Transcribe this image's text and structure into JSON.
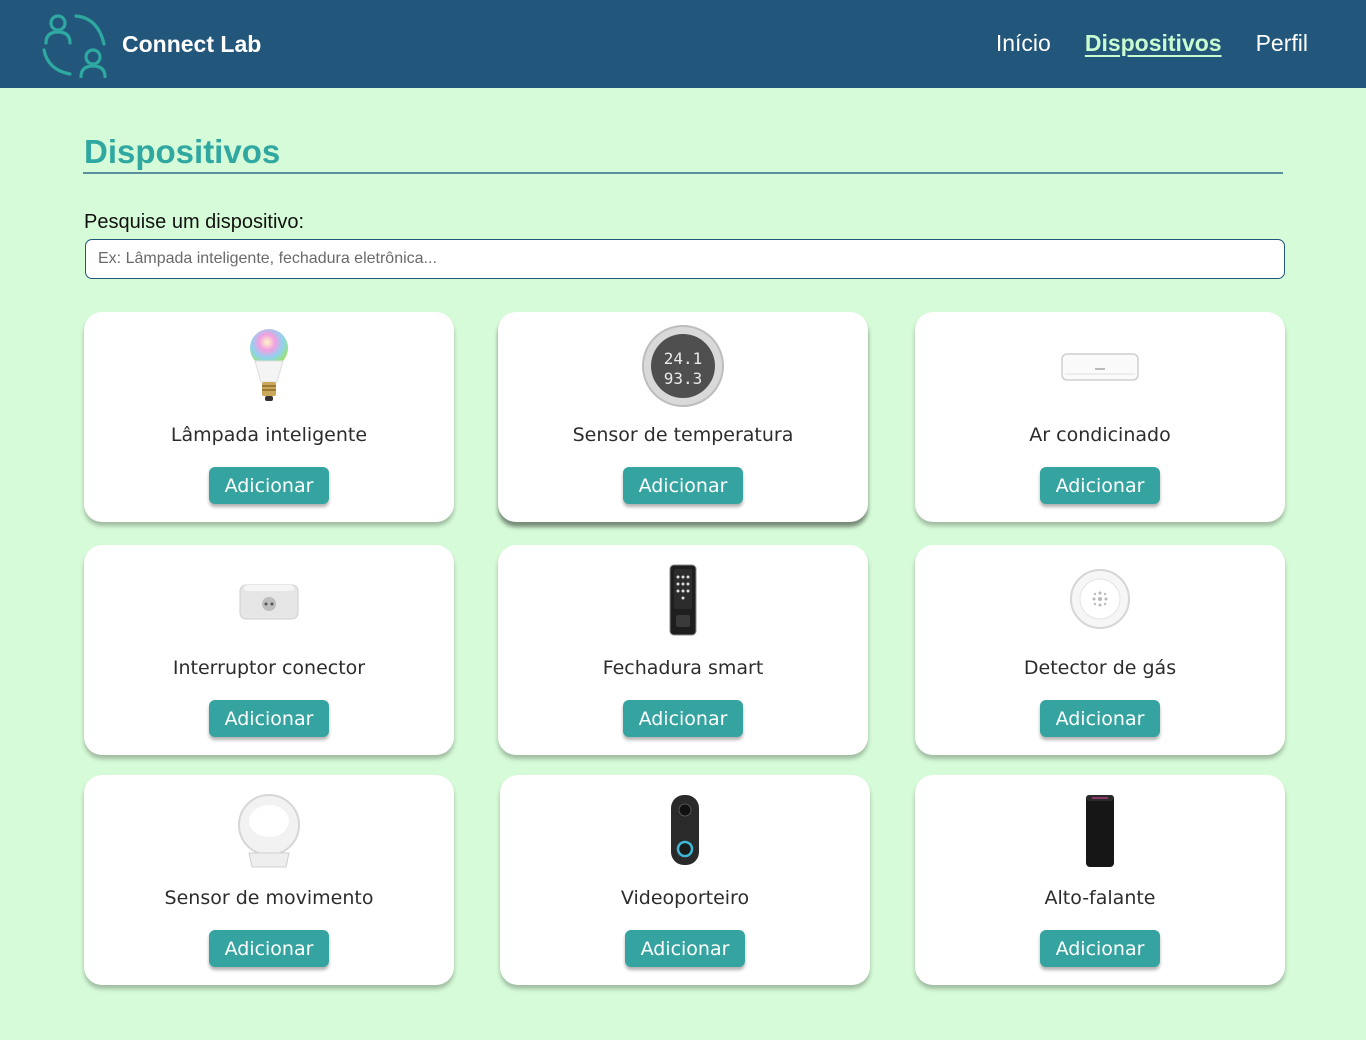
{
  "header": {
    "brand": "Connect Lab",
    "logo_icon": "people-connect-icon",
    "nav": [
      {
        "label": "Início",
        "active": false
      },
      {
        "label": "Dispositivos",
        "active": true
      },
      {
        "label": "Perfil",
        "active": false
      }
    ]
  },
  "main": {
    "title": "Dispositivos",
    "search": {
      "label": "Pesquise um dispositivo:",
      "placeholder": "Ex: Lâmpada inteligente, fechadura eletrônica...",
      "value": ""
    },
    "add_label": "Adicionar",
    "devices": [
      {
        "name": "Lâmpada inteligente",
        "icon": "smart-bulb-icon"
      },
      {
        "name": "Sensor de temperatura",
        "icon": "temperature-sensor-icon"
      },
      {
        "name": "Ar condicinado",
        "icon": "air-conditioner-icon"
      },
      {
        "name": "Interruptor conector",
        "icon": "smart-plug-icon"
      },
      {
        "name": "Fechadura smart",
        "icon": "smart-lock-icon"
      },
      {
        "name": "Detector de gás",
        "icon": "gas-detector-icon"
      },
      {
        "name": "Sensor de movimento",
        "icon": "motion-sensor-icon"
      },
      {
        "name": "Videoporteiro",
        "icon": "video-doorbell-icon"
      },
      {
        "name": "Alto-falante",
        "icon": "speaker-icon"
      }
    ]
  },
  "colors": {
    "header_bg": "#22567b",
    "page_bg": "#d6fbd8",
    "accent": "#35a4a1",
    "title": "#2ea8a0"
  }
}
